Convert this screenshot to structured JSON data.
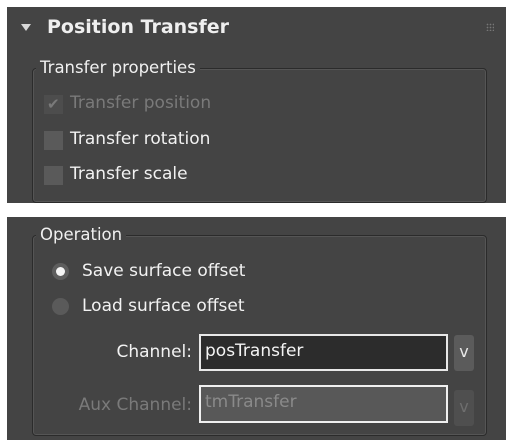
{
  "rollout": {
    "title": "Position Transfer",
    "collapse_icon": "triangle-down",
    "grip_icon": "grip-dots"
  },
  "transfer_properties": {
    "legend": "Transfer properties",
    "options": [
      {
        "label": "Transfer position",
        "checked": true,
        "enabled": false
      },
      {
        "label": "Transfer rotation",
        "checked": false,
        "enabled": true
      },
      {
        "label": "Transfer scale",
        "checked": false,
        "enabled": true
      }
    ]
  },
  "operation": {
    "legend": "Operation",
    "radios": [
      {
        "label": "Save surface offset",
        "selected": true
      },
      {
        "label": "Load surface offset",
        "selected": false
      }
    ],
    "channel": {
      "label": "Channel:",
      "value": "posTransfer",
      "button": "v",
      "enabled": true
    },
    "aux_channel": {
      "label": "Aux Channel:",
      "value": "tmTransfer",
      "button": "v",
      "enabled": false
    }
  },
  "colors": {
    "panel_bg": "#444444",
    "text": "#f0f0f0",
    "disabled_text": "#7a7a7a",
    "field_border": "#e8e8e8"
  }
}
